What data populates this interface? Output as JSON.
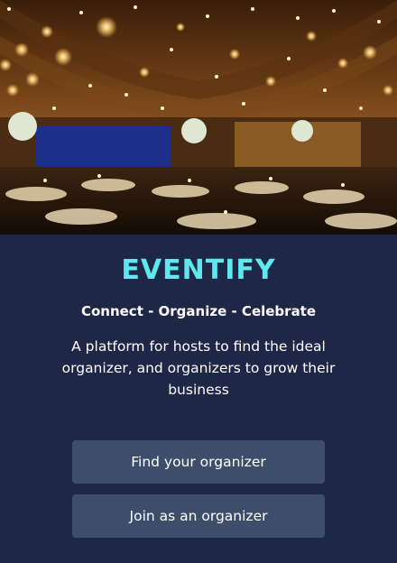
{
  "brand": {
    "name": "EVENTIFY",
    "color": "#5ee9ef"
  },
  "tagline": "Connect - Organize - Celebrate",
  "description": "A platform for hosts to find the ideal organizer, and organizers to grow their business",
  "actions": {
    "find_organizer": "Find your organizer",
    "join_organizer": "Join as an organizer"
  },
  "colors": {
    "background": "#1f2747",
    "button": "#3d4e6b",
    "text": "#ffffff"
  }
}
